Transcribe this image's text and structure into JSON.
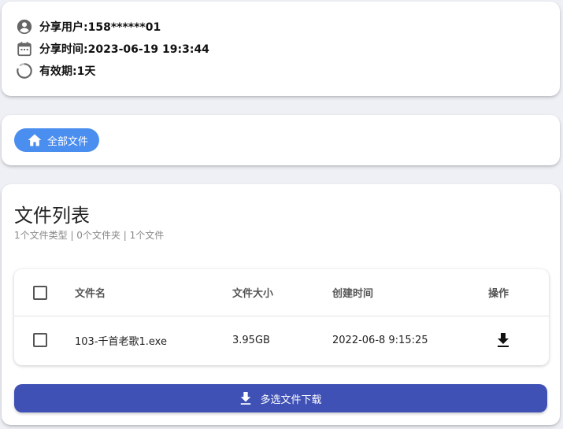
{
  "share_info": {
    "user": "分享用户:158******01",
    "time": "分享时间:2023-06-19 19:3:44",
    "validity": "有效期:1天"
  },
  "nav": {
    "home_label": "全部文件"
  },
  "file_list": {
    "title": "文件列表",
    "summary": "1个文件类型 | 0个文件夹 | 1个文件",
    "columns": {
      "name": "文件名",
      "size": "文件大小",
      "created": "创建时间",
      "action": "操作"
    },
    "rows": [
      {
        "name": "103-千首老歌1.exe",
        "size": "3.95GB",
        "created": "2022-06-8 9:15:25"
      }
    ],
    "download_selected_label": "多选文件下载"
  },
  "colors": {
    "chip_blue": "#4a8ef0",
    "download_button": "#3f51b5",
    "background": "#eef0f5"
  },
  "icons": {
    "user": "account-circle-icon",
    "time": "calendar-icon",
    "validity": "timer-ring-icon",
    "home": "home-icon",
    "download": "download-icon"
  }
}
